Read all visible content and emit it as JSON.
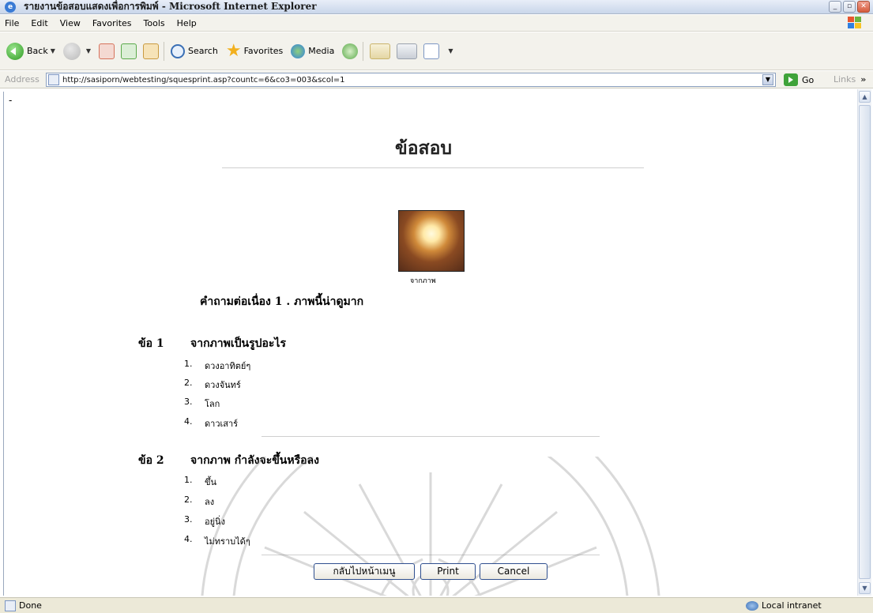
{
  "window": {
    "title": "รายงานข้อสอบแสดงเพื่อการพิมพ์ - Microsoft Internet Explorer"
  },
  "menu": [
    "File",
    "Edit",
    "View",
    "Favorites",
    "Tools",
    "Help"
  ],
  "toolbar": {
    "back": "Back",
    "search": "Search",
    "favorites": "Favorites",
    "media": "Media"
  },
  "address": {
    "label": "Address",
    "url": "http://sasiporn/webtesting/squesprint.asp?countc=6&co3=003&scol=1",
    "go": "Go",
    "links": "Links"
  },
  "page": {
    "dash": "-",
    "title": "ข้อสอบ",
    "image_caption": "จากภาพ",
    "followup": "คำถามต่อเนื่อง 1 .  ภาพนี้น่าดูมาก",
    "questions": [
      {
        "number": "ข้อ 1",
        "text": "จากภาพเป็นรูปอะไร",
        "options": [
          {
            "n": "1.",
            "t": "ดวงอาทิตย์ๆ"
          },
          {
            "n": "2.",
            "t": "ดวงจันทร์"
          },
          {
            "n": "3.",
            "t": "โลก"
          },
          {
            "n": "4.",
            "t": "ดาวเสาร์"
          }
        ]
      },
      {
        "number": "ข้อ 2",
        "text": "จากภาพ กำลังจะขึ้นหรือลง",
        "options": [
          {
            "n": "1.",
            "t": "ขึ้น"
          },
          {
            "n": "2.",
            "t": "ลง"
          },
          {
            "n": "3.",
            "t": "อยู่นิ่ง"
          },
          {
            "n": "4.",
            "t": "ไม่ทราบได้ๆ"
          }
        ]
      }
    ],
    "buttons": {
      "back_menu": "กลับไปหน้าเมนู",
      "print": "Print",
      "cancel": "Cancel"
    }
  },
  "status": {
    "text": "Done",
    "zone": "Local intranet"
  }
}
